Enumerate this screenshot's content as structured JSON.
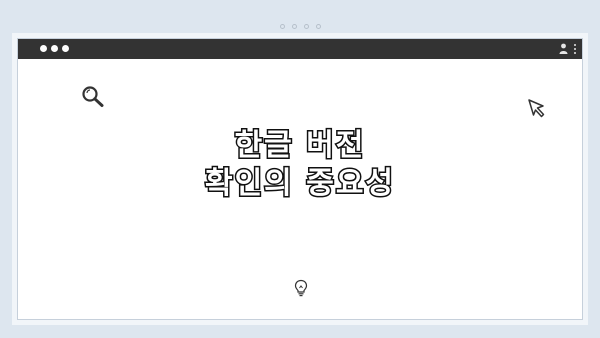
{
  "page": {
    "background_color": "#dde6ef"
  },
  "window": {
    "titlebar_color": "#333333",
    "titlebar_icons": [
      "window-dot-icon",
      "window-dot-icon",
      "window-dot-icon",
      "profile-icon",
      "kebab-menu-icon"
    ]
  },
  "content": {
    "heading_line_1": "한글 버전",
    "heading_line_2": "확인의 중요성",
    "icons": [
      "search-icon",
      "cursor-icon",
      "lightbulb-icon"
    ]
  }
}
